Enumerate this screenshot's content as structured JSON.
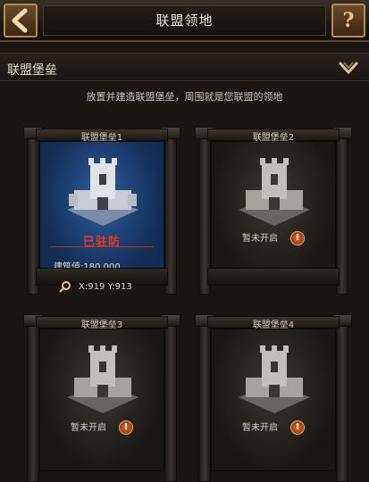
{
  "header": {
    "title": "联盟领地",
    "help_label": "?"
  },
  "section": {
    "title": "联盟堡垒"
  },
  "hint": "放置并建造联盟堡垒，周围就是您联盟的领地",
  "fortresses": [
    {
      "name": "联盟堡垒1",
      "status": "已驻防",
      "building_value": "建筑值:180,000",
      "coords": "X:919 Y:913"
    },
    {
      "name": "联盟堡垒2",
      "status": "暂未开启"
    },
    {
      "name": "联盟堡垒3",
      "status": "暂未开启"
    },
    {
      "name": "联盟堡垒4",
      "status": "暂未开启"
    }
  ],
  "colors": {
    "active_panel": "#1f4a86",
    "garrisoned_text": "#e23a2a",
    "accent_gold": "#b58a4f"
  }
}
